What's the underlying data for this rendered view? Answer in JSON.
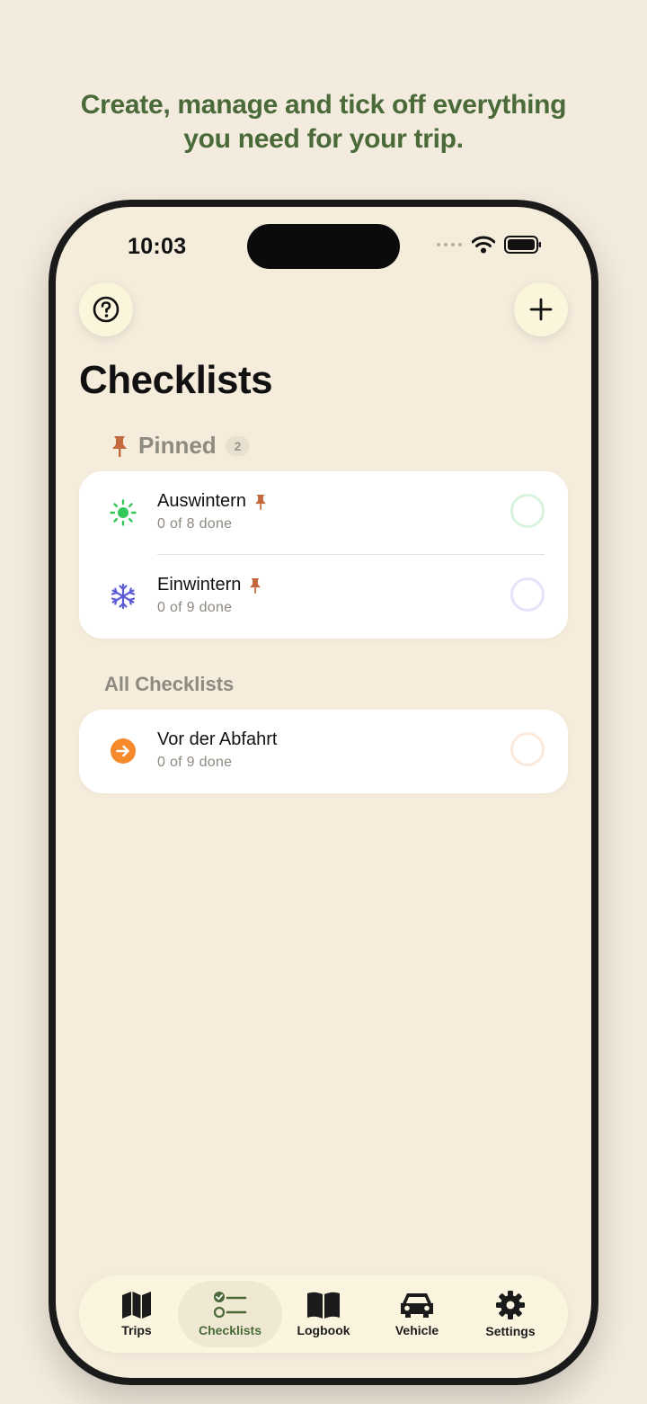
{
  "headline": {
    "line1": "Create, manage and tick off everything",
    "line2": "you need for your trip."
  },
  "status_bar": {
    "time": "10:03",
    "icons": [
      "cellular-icon",
      "wifi-icon",
      "battery-icon"
    ]
  },
  "toolbar": {
    "help_icon": "question-circle-icon",
    "add_icon": "plus-icon"
  },
  "page": {
    "title": "Checklists"
  },
  "pinned": {
    "label": "Pinned",
    "count": "2",
    "items": [
      {
        "title": "Auswintern",
        "subtitle": "0 of 8 done",
        "icon": "sun-icon",
        "color": "#34C759"
      },
      {
        "title": "Einwintern",
        "subtitle": "0 of 9 done",
        "icon": "snowflake-icon",
        "color": "#5B5BD6"
      }
    ]
  },
  "all": {
    "label": "All Checklists",
    "items": [
      {
        "title": "Vor der Abfahrt",
        "subtitle": "0 of 9 done",
        "icon": "arrow-right-circle-icon",
        "color": "#F5892B"
      }
    ]
  },
  "tabs": [
    {
      "label": "Trips",
      "icon": "map-icon"
    },
    {
      "label": "Checklists",
      "icon": "checklist-icon",
      "active": true
    },
    {
      "label": "Logbook",
      "icon": "book-icon"
    },
    {
      "label": "Vehicle",
      "icon": "car-icon"
    },
    {
      "label": "Settings",
      "icon": "gear-icon"
    }
  ],
  "colors": {
    "background": "#F3EBDD",
    "accent_green": "#4A6A3A",
    "pin": "#C4693E"
  }
}
